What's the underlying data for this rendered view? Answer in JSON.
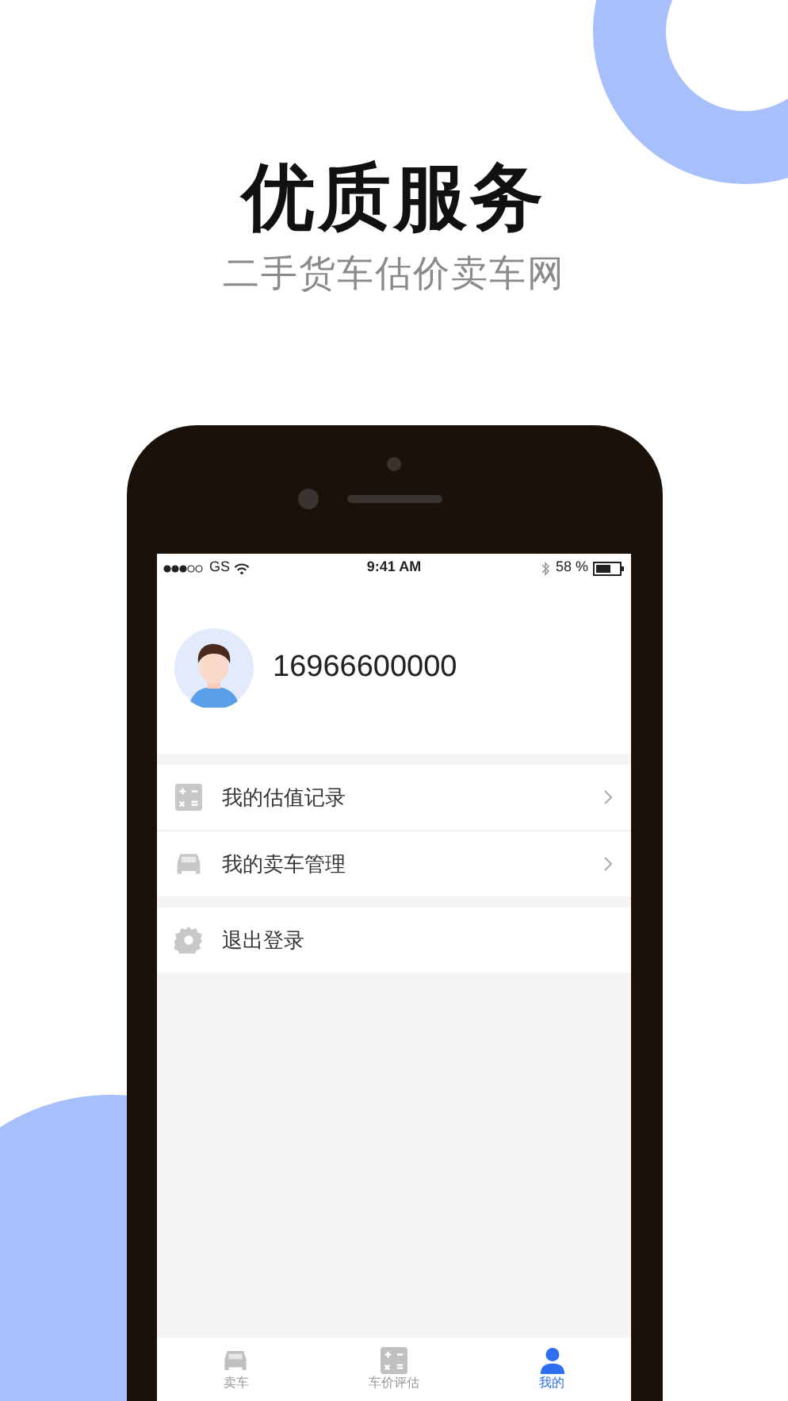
{
  "headline": "优质服务",
  "subtitle": "二手货车估价卖车网",
  "status_bar": {
    "carrier": "GS",
    "time": "9:41 AM",
    "battery": "58 %"
  },
  "profile": {
    "phone": "16966600000"
  },
  "menu": [
    {
      "label": "我的估值记录",
      "kind": "calculator",
      "arrow": true
    },
    {
      "label": "我的卖车管理",
      "kind": "car",
      "arrow": true
    },
    {
      "label": "退出登录",
      "kind": "gear",
      "arrow": false
    }
  ],
  "tabs": [
    {
      "label": "卖车",
      "kind": "car",
      "selected": false
    },
    {
      "label": "车价评估",
      "kind": "calculator",
      "selected": false
    },
    {
      "label": "我的",
      "kind": "person",
      "selected": true
    }
  ]
}
